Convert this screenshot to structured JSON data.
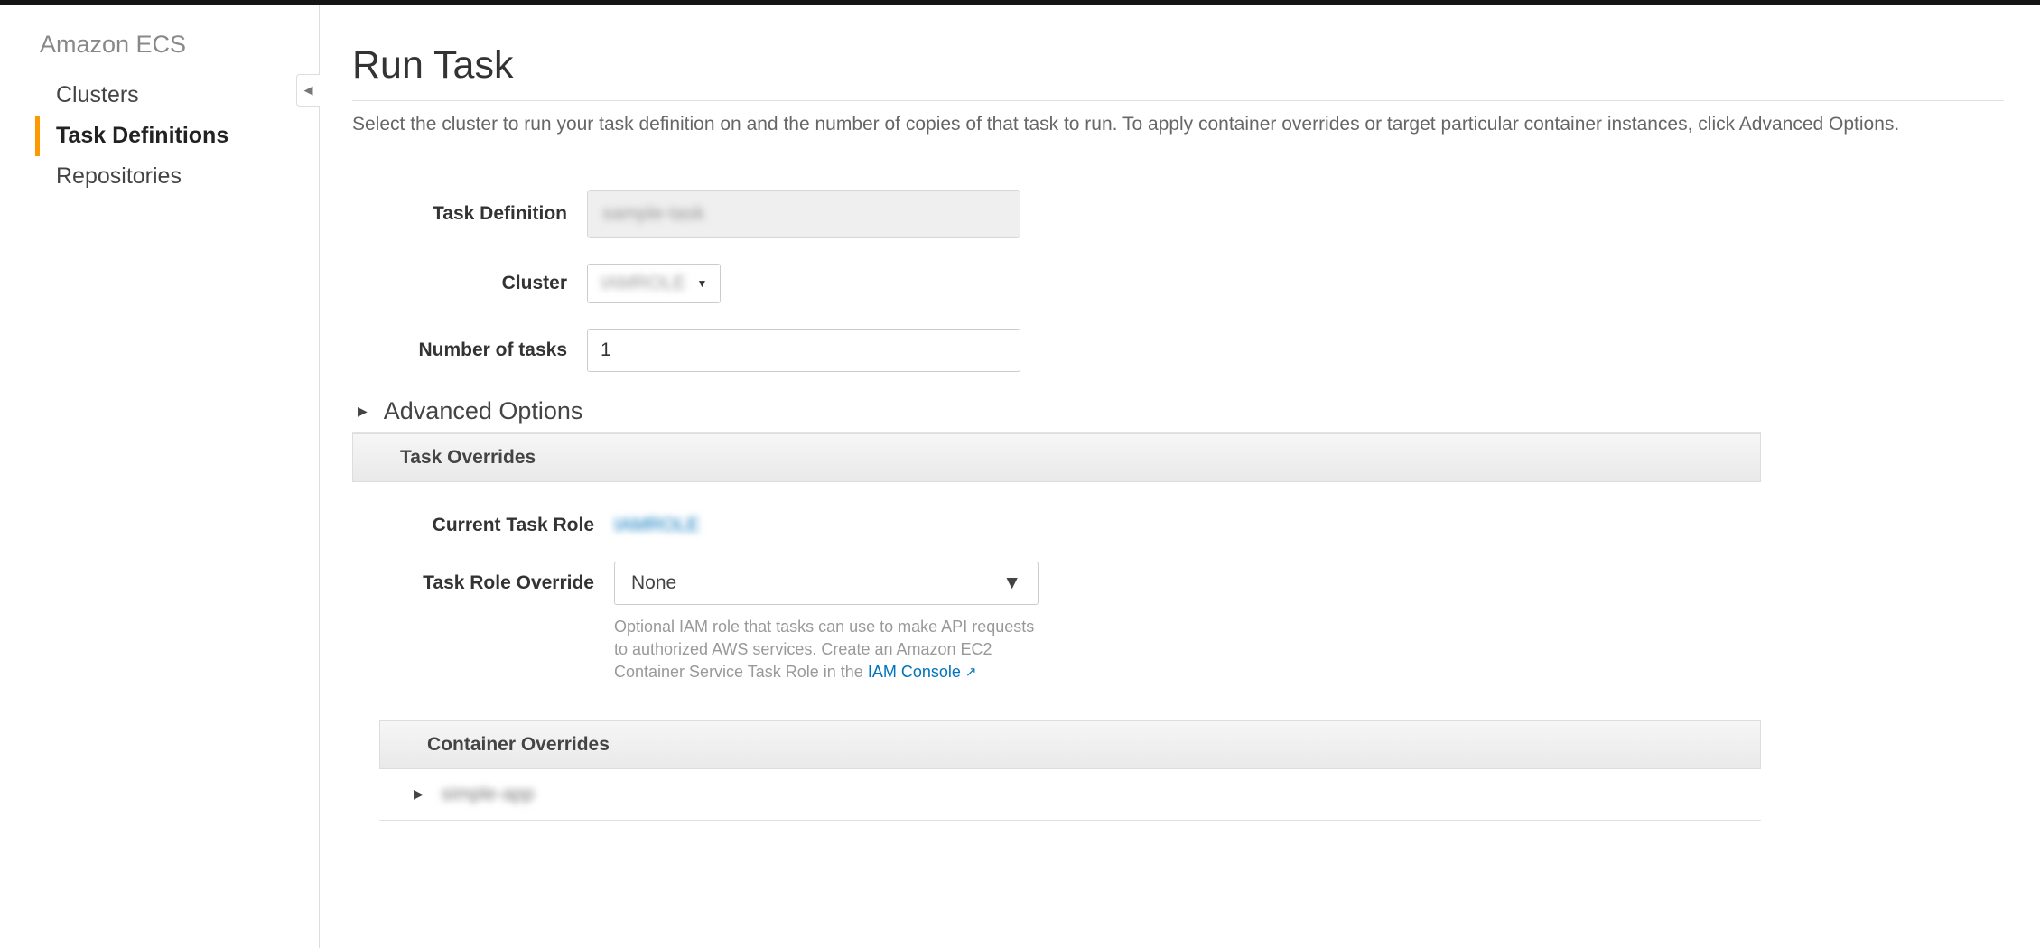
{
  "sidebar": {
    "title": "Amazon ECS",
    "items": [
      {
        "label": "Clusters",
        "active": false
      },
      {
        "label": "Task Definitions",
        "active": true
      },
      {
        "label": "Repositories",
        "active": false
      }
    ]
  },
  "page": {
    "title": "Run Task",
    "description": "Select the cluster to run your task definition on and the number of copies of that task to run. To apply container overrides or target particular container instances, click Advanced Options."
  },
  "form": {
    "task_definition_label": "Task Definition",
    "task_definition_value": "sample-task",
    "cluster_label": "Cluster",
    "cluster_value": "IAMROLE",
    "num_tasks_label": "Number of tasks",
    "num_tasks_value": "1"
  },
  "advanced": {
    "toggle_label": "Advanced Options",
    "task_overrides_header": "Task Overrides",
    "current_task_role_label": "Current Task Role",
    "current_task_role_value": "IAMROLE",
    "task_role_override_label": "Task Role Override",
    "task_role_override_value": "None",
    "helper_prefix": "Optional IAM role that tasks can use to make API requests to authorized AWS services. Create an Amazon EC2 Container Service Task Role in the ",
    "helper_link": "IAM Console",
    "container_overrides_header": "Container Overrides",
    "container_item_name": "simple-app"
  }
}
